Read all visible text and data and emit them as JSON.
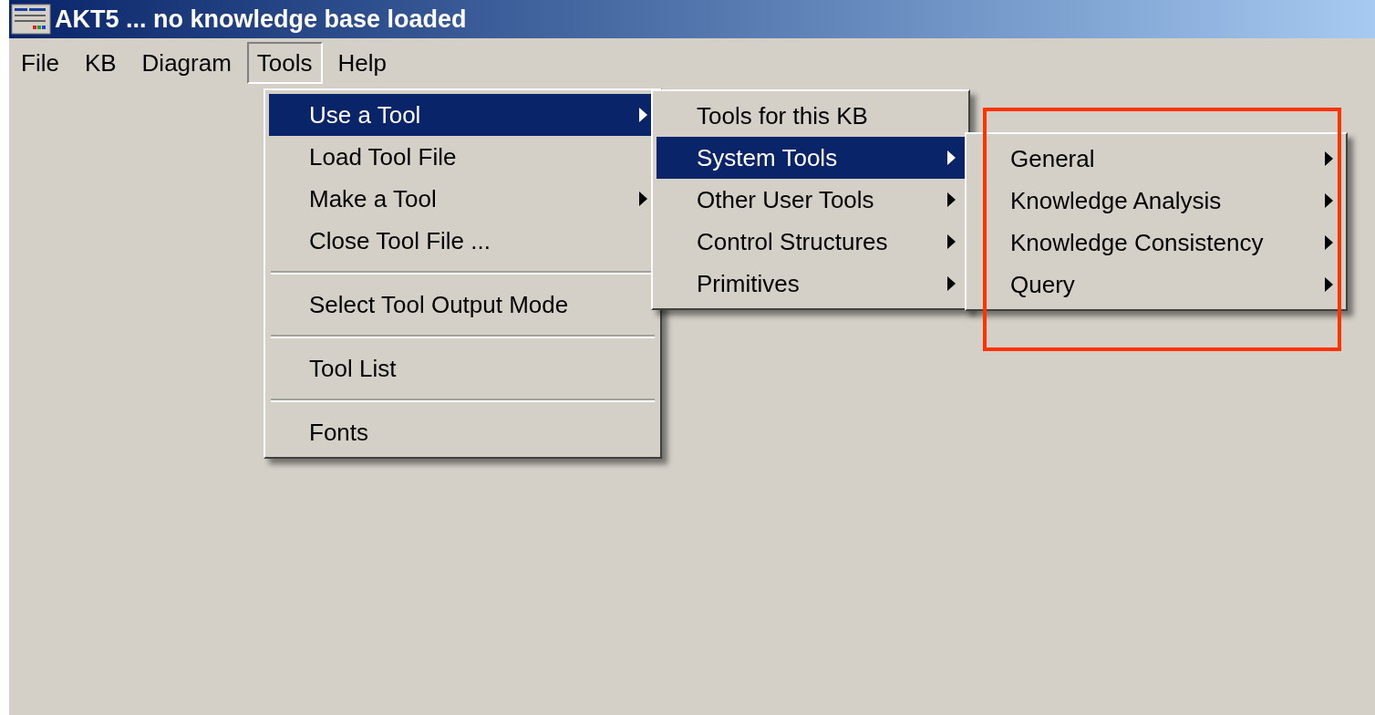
{
  "window": {
    "title": "AKT5 ... no knowledge base loaded"
  },
  "menubar": [
    {
      "label": "File",
      "selected": false
    },
    {
      "label": "KB",
      "selected": false
    },
    {
      "label": "Diagram",
      "selected": false
    },
    {
      "label": "Tools",
      "selected": true
    },
    {
      "label": "Help",
      "selected": false
    }
  ],
  "menus": [
    {
      "items": [
        {
          "kind": "item",
          "label": "Use a Tool",
          "submenu": true,
          "selected": true
        },
        {
          "kind": "item",
          "label": "Load Tool File",
          "submenu": false,
          "selected": false
        },
        {
          "kind": "item",
          "label": "Make a Tool",
          "submenu": true,
          "selected": false
        },
        {
          "kind": "item",
          "label": "Close Tool File ...",
          "submenu": false,
          "selected": false
        },
        {
          "kind": "separator"
        },
        {
          "kind": "item",
          "label": "Select Tool Output Mode",
          "submenu": false,
          "selected": false
        },
        {
          "kind": "separator"
        },
        {
          "kind": "item",
          "label": "Tool List",
          "submenu": false,
          "selected": false
        },
        {
          "kind": "separator"
        },
        {
          "kind": "item",
          "label": "Fonts",
          "submenu": false,
          "selected": false
        }
      ]
    },
    {
      "items": [
        {
          "kind": "item",
          "label": "Tools for this KB",
          "submenu": false,
          "selected": false
        },
        {
          "kind": "item",
          "label": "System Tools",
          "submenu": true,
          "selected": true
        },
        {
          "kind": "item",
          "label": "Other User Tools",
          "submenu": true,
          "selected": false
        },
        {
          "kind": "item",
          "label": "Control Structures",
          "submenu": true,
          "selected": false
        },
        {
          "kind": "item",
          "label": "Primitives",
          "submenu": true,
          "selected": false
        }
      ]
    },
    {
      "items": [
        {
          "kind": "item",
          "label": "General",
          "submenu": true,
          "selected": false
        },
        {
          "kind": "item",
          "label": "Knowledge Analysis",
          "submenu": true,
          "selected": false
        },
        {
          "kind": "item",
          "label": "Knowledge Consistency",
          "submenu": true,
          "selected": false
        },
        {
          "kind": "item",
          "label": "Query",
          "submenu": true,
          "selected": false
        }
      ]
    }
  ],
  "highlight": {
    "shown": true
  }
}
